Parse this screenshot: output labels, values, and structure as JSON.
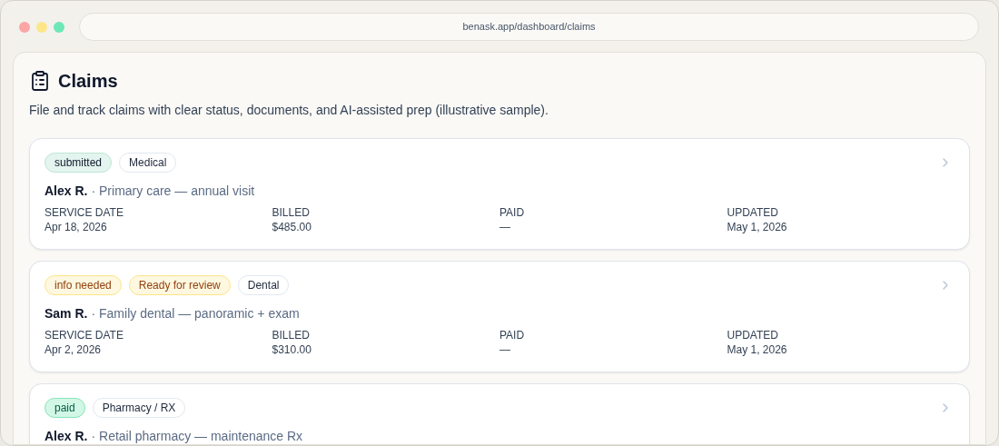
{
  "browser": {
    "url": "benask.app/dashboard/claims"
  },
  "page": {
    "title": "Claims",
    "subtitle": "File and track claims with clear status, documents, and AI-assisted prep (illustrative sample)."
  },
  "claims": [
    {
      "tags": [
        {
          "label": "submitted",
          "kind": "submitted"
        },
        {
          "label": "Medical",
          "kind": "category"
        }
      ],
      "person": "Alex R.",
      "description": "· Primary care — annual visit",
      "fields": [
        {
          "label": "SERVICE DATE",
          "value": "Apr 18, 2026"
        },
        {
          "label": "BILLED",
          "value": "$485.00"
        },
        {
          "label": "PAID",
          "value": "—"
        },
        {
          "label": "UPDATED",
          "value": "May 1, 2026"
        }
      ]
    },
    {
      "tags": [
        {
          "label": "info needed",
          "kind": "warning"
        },
        {
          "label": "Ready for review",
          "kind": "warning"
        },
        {
          "label": "Dental",
          "kind": "category"
        }
      ],
      "person": "Sam R.",
      "description": "· Family dental — panoramic + exam",
      "fields": [
        {
          "label": "SERVICE DATE",
          "value": "Apr 2, 2026"
        },
        {
          "label": "BILLED",
          "value": "$310.00"
        },
        {
          "label": "PAID",
          "value": "—"
        },
        {
          "label": "UPDATED",
          "value": "May 1, 2026"
        }
      ]
    },
    {
      "tags": [
        {
          "label": "paid",
          "kind": "paid"
        },
        {
          "label": "Pharmacy / RX",
          "kind": "category"
        }
      ],
      "person": "Alex R.",
      "description": "· Retail pharmacy — maintenance Rx"
    }
  ]
}
